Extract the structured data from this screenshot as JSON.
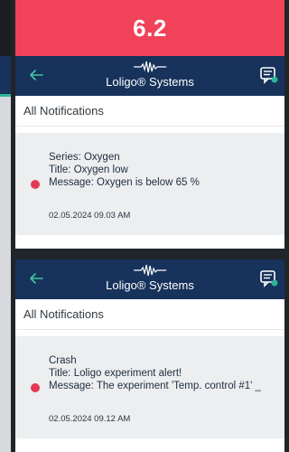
{
  "header": {
    "version": "6.2"
  },
  "brand": {
    "name": "Loligo® Systems"
  },
  "section_title": "All Notifications",
  "notifications": [
    {
      "line1": "Series: Oxygen",
      "line2": "Title: Oxygen low",
      "line3": "Message: Oxygen is below 65 %",
      "date": "02.05.2024 09.03 AM"
    },
    {
      "line1": "Crash",
      "line2": "Title: Loligo experiment alert!",
      "line3": "Message: The experiment 'Temp. control #1' _",
      "date": "02.05.2024 09.12 AM"
    }
  ],
  "colors": {
    "header_red": "#f04259",
    "app_bar_navy": "#17325b",
    "accent_green": "#2fb39a",
    "unread_dot": "#e23a55"
  },
  "icons": {
    "back": "arrow-left-icon",
    "chat": "chat-bubble-icon",
    "logo": "loligo-wave-logo"
  }
}
